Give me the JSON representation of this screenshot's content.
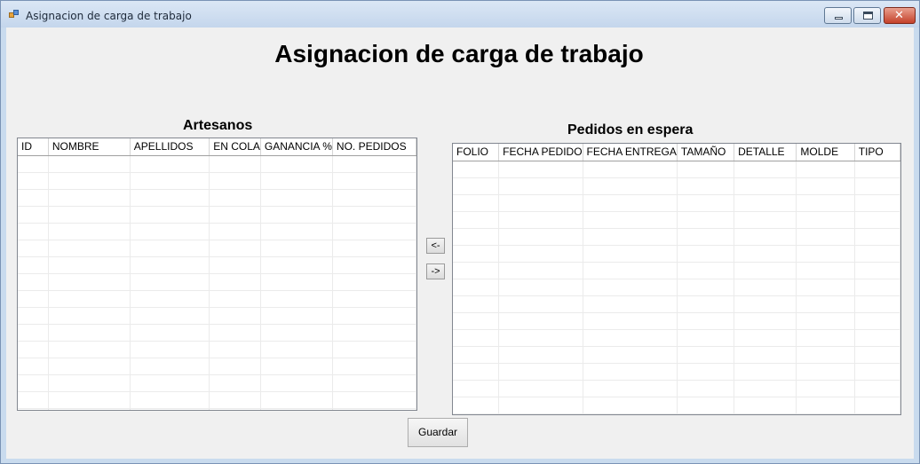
{
  "window": {
    "title": "Asignacion de carga de trabajo",
    "close_glyph": "✕"
  },
  "main": {
    "heading": "Asignacion de carga de trabajo"
  },
  "artesanos": {
    "title": "Artesanos",
    "columns": [
      "ID",
      "NOMBRE",
      "APELLIDOS",
      "EN COLA",
      "GANANCIA %",
      "NO. PEDIDOS"
    ],
    "row_count": 16
  },
  "pedidos": {
    "title": "Pedidos en espera",
    "columns": [
      "FOLIO",
      "FECHA PEDIDO",
      "FECHA ENTREGA",
      "TAMAÑO",
      "DETALLE",
      "MOLDE",
      "TIPO"
    ],
    "row_count": 15
  },
  "buttons": {
    "move_left": "<-",
    "move_right": "->",
    "save": "Guardar"
  }
}
